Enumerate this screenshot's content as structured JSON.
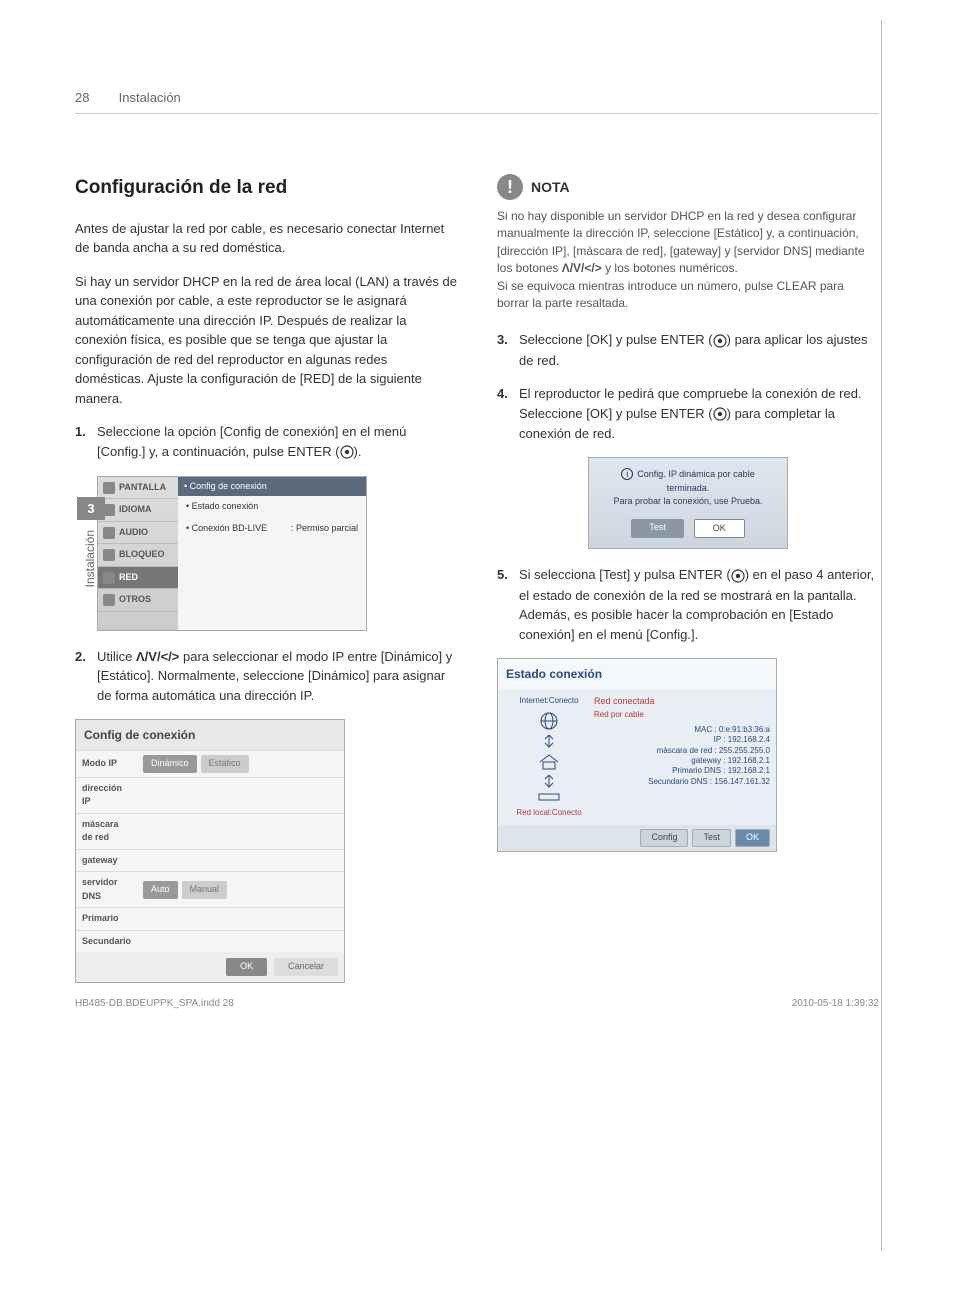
{
  "header": {
    "page_number": "28",
    "section": "Instalación"
  },
  "sidetab": {
    "chapter": "3",
    "label": "Instalación"
  },
  "left": {
    "title": "Configuración de la red",
    "intro1": "Antes de ajustar la red por cable, es necesario conectar Internet de banda ancha a su red doméstica.",
    "intro2": "Si hay un servidor DHCP en la red de área local (LAN) a través de una conexión por cable, a este reproductor se le asignará automáticamente una dirección IP. Después de realizar la conexión física, es posible que se tenga que ajustar la configuración de red del reproductor en algunas redes domésticas. Ajuste la configuración de [RED] de la siguiente manera.",
    "step1_n": "1.",
    "step1": "Seleccione la opción [Config de conexión] en el menú [Config.] y, a continuación, pulse ENTER (",
    "step1_tail": ").",
    "shot1": {
      "menu": [
        "PANTALLA",
        "IDIOMA",
        "AUDIO",
        "BLOQUEO",
        "RED",
        "OTROS"
      ],
      "panel_title": "• Config de conexión",
      "row1": "• Estado conexión",
      "row2_l": "• Conexión BD-LIVE",
      "row2_r": ": Permiso parcial"
    },
    "step2_n": "2.",
    "step2_a": "Utilice ",
    "step2_nav": "Λ/V/</>",
    "step2_b": " para seleccionar el modo IP entre [Dinámico] y [Estático]. Normalmente, seleccione [Dinámico] para asignar de forma automática una dirección IP.",
    "shot2": {
      "title": "Config de conexión",
      "rows": {
        "modo": "Modo IP",
        "dinamico": "Dinámico",
        "estatico": "Estático",
        "dir": "dirección IP",
        "mask": "máscara de red",
        "gw": "gateway",
        "dns": "servidor DNS",
        "auto": "Auto",
        "manual": "Manual",
        "prim": "Primario",
        "sec": "Secundario"
      },
      "ok": "OK",
      "cancel": "Cancelar"
    }
  },
  "right": {
    "nota_label": "NOTA",
    "nota_text_a": "Si no hay disponible un servidor DHCP en la red y desea configurar manualmente la dirección IP, seleccione [Estático] y, a continuación, [dirección IP], [máscara de red], [gateway] y [servidor DNS] mediante los botones ",
    "nota_nav": "Λ/V/</>",
    "nota_text_b": " y los botones numéricos.",
    "nota_text_c": "Si se equivoca mientras introduce un número, pulse CLEAR para borrar la parte resaltada.",
    "step3_n": "3.",
    "step3_a": "Seleccione  [OK] y pulse ENTER (",
    "step3_b": ") para aplicar los ajustes de red.",
    "step4_n": "4.",
    "step4_a": "El reproductor le pedirá que compruebe la conexión de red. Seleccione [OK] y pulse ENTER (",
    "step4_b": ") para completar la conexión de red.",
    "shot3": {
      "line1": "Config. IP dinámica por cable terminada.",
      "line2": "Para probar la conexión, use Prueba.",
      "test": "Test",
      "ok": "OK"
    },
    "step5_n": "5.",
    "step5_a": "Si selecciona [Test] y pulsa ENTER (",
    "step5_b": ") en el paso 4 anterior, el estado de conexión de la red se mostrará en la pantalla.",
    "step5_c": "Además, es posible hacer la comprobación en [Estado conexión] en el menú [Config.].",
    "shot4": {
      "title": "Estado conexión",
      "internet": "Internet:Conecto",
      "local": "Red local:Conecto",
      "r_hdr": "Red conectada",
      "r_sub": "Red por cable",
      "mac": "MAC : 0:e:91:b3:36:a",
      "ip": "IP : 192.168.2.4",
      "mask": "máscara de red : 255.255.255.0",
      "gw": "gateway : 192.168.2.1",
      "dns1": "Primario DNS : 192.168.2.1",
      "dns2": "Secundario DNS : 156.147.161.32",
      "config": "Config",
      "test": "Test",
      "ok": "OK"
    }
  },
  "footer": {
    "file": "HB485-DB.BDEUPPK_SPA.indd   28",
    "stamp": "2010-05-18     1:39:32"
  }
}
